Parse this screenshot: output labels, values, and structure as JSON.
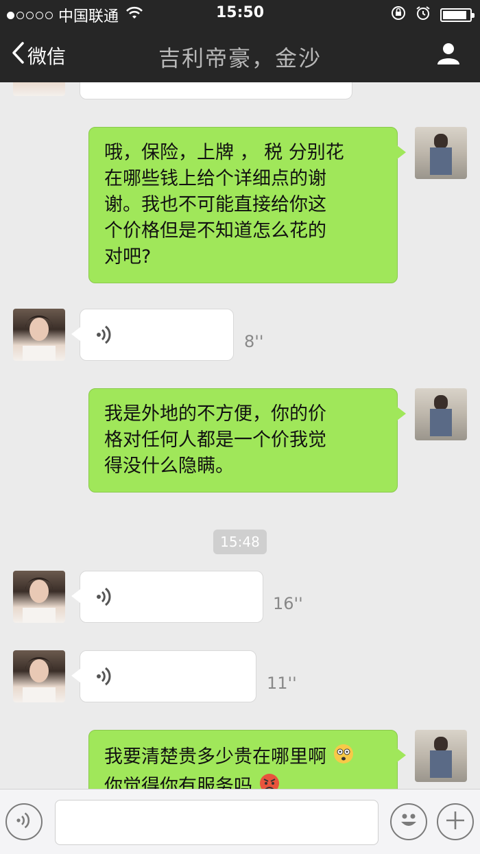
{
  "status_bar": {
    "carrier": "中国联通",
    "time": "15:50",
    "battery_level_percent": 90,
    "icons": [
      "signal-dots-icon",
      "wifi-icon",
      "rotation-lock-icon",
      "alarm-icon",
      "battery-icon"
    ]
  },
  "nav": {
    "back_label": "微信",
    "title": "吉利帝豪，金沙",
    "profile_icon": "person-icon"
  },
  "messages": [
    {
      "id": "m1",
      "direction": "out",
      "type": "text",
      "lines": [
        "哦，保险，上牌 ，  税  分别花",
        "在哪些钱上给个详细点的谢",
        "谢。我也不可能直接给你这",
        "个价格但是不知道怎么花的",
        "对吧?"
      ]
    },
    {
      "id": "m2",
      "direction": "in",
      "type": "voice",
      "duration": "8''"
    },
    {
      "id": "m3",
      "direction": "out",
      "type": "text",
      "lines": [
        "我是外地的不方便，你的价",
        "格对任何人都是一个价我觉",
        "得没什么隐瞒。"
      ]
    },
    {
      "id": "t1",
      "type": "timestamp",
      "text": "15:48"
    },
    {
      "id": "m4",
      "direction": "in",
      "type": "voice",
      "duration": "16''"
    },
    {
      "id": "m5",
      "direction": "in",
      "type": "voice",
      "duration": "11''"
    },
    {
      "id": "m6",
      "direction": "out",
      "type": "text",
      "lines": [
        "我要清楚贵多少贵在哪里啊",
        "你觉得你有服务吗"
      ],
      "emojis": [
        "dizzy-face-icon",
        "angry-face-icon"
      ]
    }
  ],
  "input_bar": {
    "voice_button_icon": "voice-icon",
    "input_value": "",
    "emoji_button_icon": "smiley-icon",
    "add_button_icon": "plus-icon"
  },
  "colors": {
    "outgoing_bubble": "#a0e75a",
    "incoming_bubble": "#ffffff",
    "nav_background": "#262626",
    "chat_background": "#ebebeb"
  }
}
